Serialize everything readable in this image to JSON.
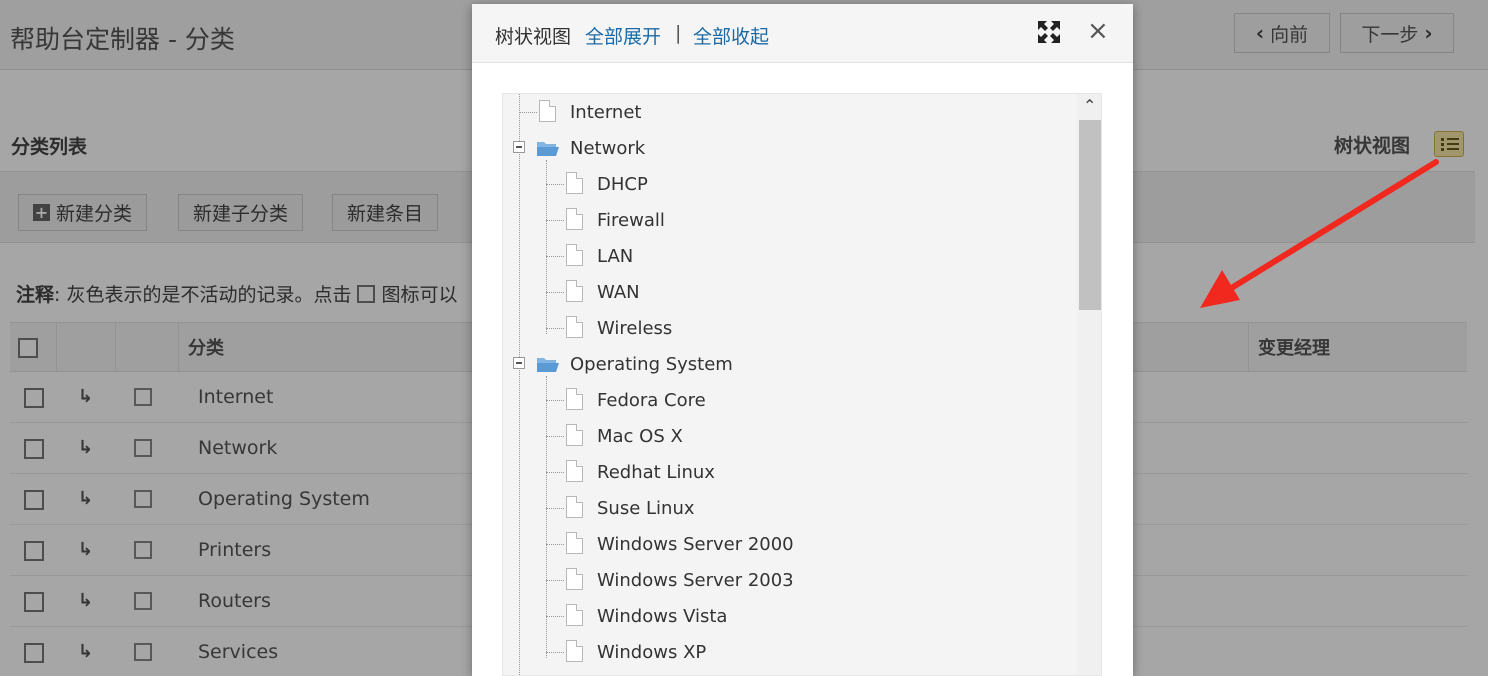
{
  "page": {
    "title": "帮助台定制器 - 分类",
    "nav": {
      "prev": "向前",
      "next": "下一步"
    },
    "section_title": "分类列表",
    "tree_view_link": "树状视图",
    "toolbar": {
      "new_category": "新建分类",
      "new_subcategory": "新建子分类",
      "new_item": "新建条目"
    },
    "note": {
      "label": "注释",
      "text_before": ": 灰色表示的是不活动的记录。点击",
      "text_after": "图标可以"
    },
    "table": {
      "headers": {
        "category": "分类",
        "change_manager": "变更经理"
      },
      "rows": [
        "Internet",
        "Network",
        "Operating System",
        "Printers",
        "Routers",
        "Services"
      ]
    }
  },
  "modal": {
    "title": "树状视图",
    "expand_all": "全部展开",
    "separator": "|",
    "collapse_all": "全部收起",
    "close": "×",
    "tree": {
      "n0": "Internet",
      "n1": "Network",
      "n2": "DHCP",
      "n3": "Firewall",
      "n4": "LAN",
      "n5": "WAN",
      "n6": "Wireless",
      "n7": "Operating System",
      "n8": "Fedora Core",
      "n9": "Mac OS X",
      "n10": "Redhat Linux",
      "n11": "Suse Linux",
      "n12": "Windows Server 2000",
      "n13": "Windows Server 2003",
      "n14": "Windows Vista",
      "n15": "Windows XP"
    }
  },
  "colors": {
    "link": "#1a6aa8",
    "arrow": "#f0281e",
    "overlay": "rgba(0,0,0,0.35)"
  },
  "icons": [
    "expand-icon",
    "close-icon",
    "file-icon",
    "folder-open-icon",
    "tree-view-icon",
    "edit-icon",
    "subitem-arrow-icon",
    "plus-icon"
  ]
}
